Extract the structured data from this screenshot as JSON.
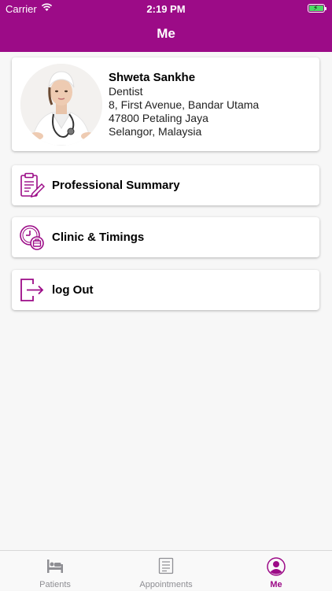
{
  "status_bar": {
    "carrier": "Carrier",
    "time": "2:19 PM"
  },
  "header": {
    "title": "Me"
  },
  "profile": {
    "name": "Shweta Sankhe",
    "specialty": "Dentist",
    "address_line1": "8, First Avenue, Bandar Utama",
    "address_line2": "47800 Petaling Jaya",
    "address_line3": "Selangor, Malaysia"
  },
  "menu": [
    {
      "label": "Professional Summary",
      "icon": "clipboard-edit-icon"
    },
    {
      "label": "Clinic & Timings",
      "icon": "clock-briefcase-icon"
    },
    {
      "label": "log Out",
      "icon": "logout-icon"
    }
  ],
  "tabs": [
    {
      "label": "Patients",
      "icon": "bed-icon",
      "active": false
    },
    {
      "label": "Appointments",
      "icon": "calendar-page-icon",
      "active": false
    },
    {
      "label": "Me",
      "icon": "person-icon",
      "active": true
    }
  ],
  "colors": {
    "brand": "#9c0b87",
    "tab_inactive": "#8e8e93",
    "background": "#f7f7f7"
  }
}
